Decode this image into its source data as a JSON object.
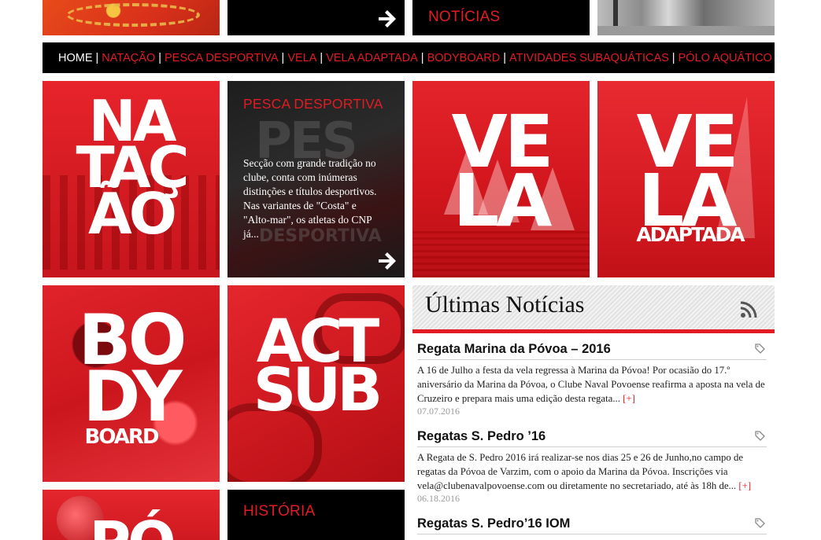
{
  "top_row": {
    "noticias_label": "NOTÍCIAS"
  },
  "nav": {
    "items": [
      {
        "label": "HOME",
        "active": true
      },
      {
        "label": "NATAÇÃO"
      },
      {
        "label": "PESCA DESPORTIVA"
      },
      {
        "label": "VELA"
      },
      {
        "label": "VELA ADAPTADA"
      },
      {
        "label": "BODYBOARD"
      },
      {
        "label": "ATIVIDADES SUBAQUÁTICAS"
      },
      {
        "label": "PÓLO AQUÁTICO"
      }
    ],
    "separator": "|"
  },
  "tiles": {
    "natacao": {
      "line1": "NA",
      "line2": "TAÇ",
      "line3": "ÃO"
    },
    "pesca": {
      "heading": "PESCA DESPORTIVA",
      "ghost_text": "PES",
      "ghost_sub": "DESPORTIVA",
      "description": "Secção com grande tradição no clube, conta com inúmeras distinções e títulos desportivos. Nas variantes de \"Costa\" e \"Alto-mar\", os atletas do CNP já..."
    },
    "vela": {
      "line1": "VE",
      "line2": "LA"
    },
    "vela_adaptada": {
      "line1": "VE",
      "line2": "LA",
      "sub": "ADAPTADA"
    },
    "bodyboard": {
      "line1": "BO",
      "line2": "DY",
      "sub": "BOARD"
    },
    "actsub": {
      "line1": "ACT",
      "line2": "SUB"
    },
    "polo": {
      "partial": "PÓ"
    },
    "historia": {
      "heading": "HISTÓRIA"
    }
  },
  "news": {
    "title": "Últimas Notícias",
    "items": [
      {
        "title": "Regata Marina da Póvoa – 2016",
        "excerpt": "A 16 de Julho a festa da vela regressa à Marina da Póvoa! Por ocasião do 17.º aniversário da Marina da Póvoa, o Clube Naval Povoense reafirma a aposta na vela de Cruzeiro e prepara mais uma edição desta regata...",
        "more": "[+]",
        "date": "07.07.2016"
      },
      {
        "title": "Regatas S. Pedro ’16",
        "excerpt": "A Regata de S. Pedro 2016 irá realizar-se nos dias 25 e 26 de Junho,no campo de regatas da Póvoa de Varzim, com o apoio da Marina da Póvoa. Inscrições via vela@clubenavalpovoense.com ou diretamente no secretariado, até às 18h de...",
        "more": "[+]",
        "date": "06.18.2016"
      },
      {
        "title": "Regatas S. Pedro’16 IOM",
        "excerpt": "",
        "more": "",
        "date": ""
      }
    ]
  },
  "colors": {
    "accent": "#e31b23",
    "nav_bg": "#000000",
    "text": "#111111"
  }
}
